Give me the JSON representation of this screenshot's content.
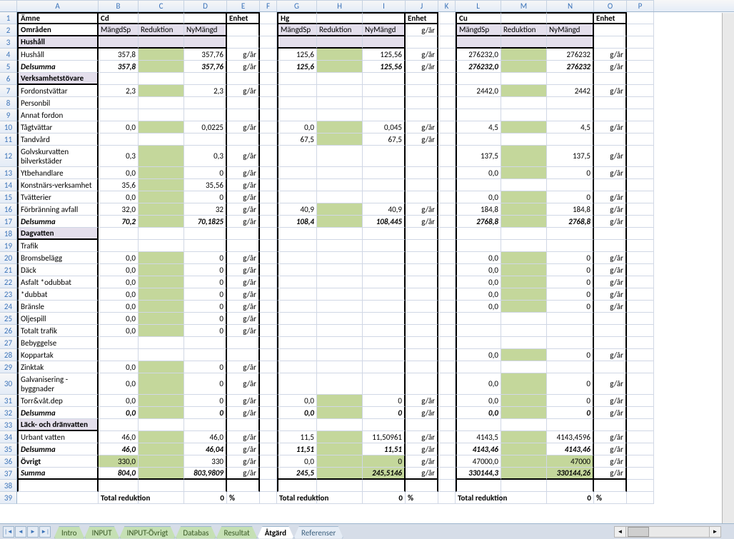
{
  "cols": [
    "A",
    "B",
    "C",
    "D",
    "E",
    "F",
    "G",
    "H",
    "I",
    "J",
    "K",
    "L",
    "M",
    "N",
    "O",
    "P"
  ],
  "row1": {
    "amne": "Ämne",
    "cd": "Cd",
    "enhet": "Enhet",
    "hg": "Hg",
    "cu": "Cu"
  },
  "row2": {
    "omraden": "Områden",
    "mangd": "MängdSp",
    "red": "Reduktion",
    "nym": "NyMängd",
    "gar": "g/år"
  },
  "row3": {
    "hushall": "Hushåll"
  },
  "rows": [
    {
      "n": 4,
      "a": "Hushåll",
      "b": "357,8",
      "d": "357,76",
      "e": "g/år",
      "g": "125,6",
      "i": "125,56",
      "j": "g/år",
      "l": "276232,0",
      "nn": "276232",
      "o": "g/år"
    },
    {
      "n": 5,
      "a": "Delsumma",
      "ital": true,
      "b": "357,8",
      "d": "357,76",
      "e": "g/år",
      "g": "125,6",
      "i": "125,56",
      "j": "g/år",
      "l": "276232,0",
      "nn": "276232",
      "o": "g/år"
    },
    {
      "n": 6,
      "a": "Verksamhetstövare",
      "sect": true
    },
    {
      "n": 7,
      "a": "Fordonstvättar",
      "b": "2,3",
      "d": "2,3",
      "e": "g/år",
      "l": "2442,0",
      "nn": "2442",
      "o": "g/år"
    },
    {
      "n": 8,
      "a": "     Personbil"
    },
    {
      "n": 9,
      "a": "     Annat fordon"
    },
    {
      "n": 10,
      "a": "Tågtvättar",
      "b": "0,0",
      "d": "0,0225",
      "e": "g/år",
      "g": "0,0",
      "i": "0,045",
      "j": "g/år",
      "l": "4,5",
      "nn": "4,5",
      "o": "g/år"
    },
    {
      "n": 11,
      "a": "Tandvård",
      "g": "67,5",
      "i": "67,5",
      "j": "g/år"
    },
    {
      "n": 12,
      "a": "Golvskurvatten bilverkstäder",
      "tall": true,
      "b": "0,3",
      "d": "0,3",
      "e": "g/år",
      "l": "137,5",
      "nn": "137,5",
      "o": "g/år"
    },
    {
      "n": 13,
      "a": "Ytbehandlare",
      "b": "0,0",
      "d": "0",
      "e": "g/år",
      "l": "0,0",
      "nn": "0",
      "o": "g/år"
    },
    {
      "n": 14,
      "a": "Konstnärs-verksamhet",
      "b": "35,6",
      "d": "35,56",
      "e": "g/år"
    },
    {
      "n": 15,
      "a": "Tvätterier",
      "b": "0,0",
      "d": "0",
      "e": "g/år",
      "l": "0,0",
      "nn": "0",
      "o": "g/år"
    },
    {
      "n": 16,
      "a": "Förbränning avfall",
      "b": "32,0",
      "d": "32",
      "e": "g/år",
      "g": "40,9",
      "i": "40,9",
      "j": "g/år",
      "l": "184,8",
      "nn": "184,8",
      "o": "g/år"
    },
    {
      "n": 17,
      "a": "Delsumma",
      "ital": true,
      "b": "70,2",
      "d": "70,1825",
      "e": "g/år",
      "g": "108,4",
      "i": "108,445",
      "j": "g/år",
      "l": "2768,8",
      "nn": "2768,8",
      "o": "g/år"
    },
    {
      "n": 18,
      "a": "Dagvatten",
      "sect": true
    },
    {
      "n": 19,
      "a": "Trafik"
    },
    {
      "n": 20,
      "a": "Bromsbelägg",
      "b": "0,0",
      "d": "0",
      "e": "g/år",
      "l": "0,0",
      "nn": "0",
      "o": "g/år"
    },
    {
      "n": 21,
      "a": "Däck",
      "b": "0,0",
      "d": "0",
      "e": "g/år",
      "l": "0,0",
      "nn": "0",
      "o": "g/år"
    },
    {
      "n": 22,
      "a": "Asfalt       *odubbat",
      "b": "0,0",
      "d": "0",
      "e": "g/år",
      "l": "0,0",
      "nn": "0",
      "o": "g/år"
    },
    {
      "n": 23,
      "a": "*dubbat",
      "b": "0,0",
      "d": "0",
      "e": "g/år",
      "l": "0,0",
      "nn": "0",
      "o": "g/år"
    },
    {
      "n": 24,
      "a": "Bränsle",
      "b": "0,0",
      "d": "0",
      "e": "g/år",
      "l": "0,0",
      "nn": "0",
      "o": "g/år"
    },
    {
      "n": 25,
      "a": "Oljespill",
      "b": "0,0",
      "d": "0",
      "e": "g/år"
    },
    {
      "n": 26,
      "a": "Totalt trafik",
      "b": "0,0",
      "d": "0",
      "e": "g/år"
    },
    {
      "n": 27,
      "a": "Bebyggelse"
    },
    {
      "n": 28,
      "a": "Koppartak",
      "l": "0,0",
      "nn": "0",
      "o": "g/år"
    },
    {
      "n": 29,
      "a": "Zinktak",
      "b": "0,0",
      "d": "0",
      "e": "g/år"
    },
    {
      "n": 30,
      "a": "Galvanisering - byggnader",
      "tall": true,
      "b": "0,0",
      "d": "0",
      "e": "g/år",
      "l": "0,0",
      "nn": "0",
      "o": "g/år"
    },
    {
      "n": 31,
      "a": "Torr&våt.dep",
      "b": "0,0",
      "d": "0",
      "e": "g/år",
      "g": "0,0",
      "i": "0",
      "j": "g/år",
      "l": "0,0",
      "nn": "0",
      "o": "g/år"
    },
    {
      "n": 32,
      "a": "Delsumma",
      "ital": true,
      "b": "0,0",
      "d": "0",
      "e": "g/år",
      "g": "0,0",
      "i": "0",
      "j": "g/år",
      "l": "0,0",
      "nn": "0",
      "o": "g/år"
    },
    {
      "n": 33,
      "a": "Läck- och dränvatten",
      "sect": true
    },
    {
      "n": 34,
      "a": "Urbant vatten",
      "b": "46,0",
      "d": "46,0",
      "e": "g/år",
      "g": "11,5",
      "i": "11,50961",
      "j": "g/år",
      "l": "4143,5",
      "nn": "4143,4596",
      "o": "g/år"
    },
    {
      "n": 35,
      "a": "Delsumma",
      "ital": true,
      "b": "46,0",
      "d": "46,04",
      "e": "g/år",
      "g": "11,51",
      "i": "11,51",
      "j": "g/år",
      "l": "4143,46",
      "nn": "4143,46",
      "o": "g/år"
    },
    {
      "n": 36,
      "a": "Övrigt",
      "bold": true,
      "b": "330,0",
      "bgreen": true,
      "d": "330",
      "e": "g/år",
      "g": "0,0",
      "i": "0",
      "j": "g/år",
      "l": "47000,0",
      "nn": "47000",
      "o": "g/år"
    },
    {
      "n": 37,
      "a": "Summa",
      "ital": true,
      "bbot": true,
      "b": "804,0",
      "d": "803,9809",
      "e": "g/år",
      "g": "245,5",
      "i": "245,5146",
      "j": "g/år",
      "l": "330144,3",
      "nn": "330144,26",
      "o": "g/år"
    },
    {
      "n": 38,
      "blank": true
    }
  ],
  "row39": {
    "label": "Total reduktion",
    "val": "0",
    "unit": "%"
  },
  "tabs": [
    "Intro",
    "INPUT",
    "INPUT-Övrigt",
    "Databas",
    "Resultat",
    "Åtgärd",
    "Referenser"
  ],
  "activeTab": 5
}
